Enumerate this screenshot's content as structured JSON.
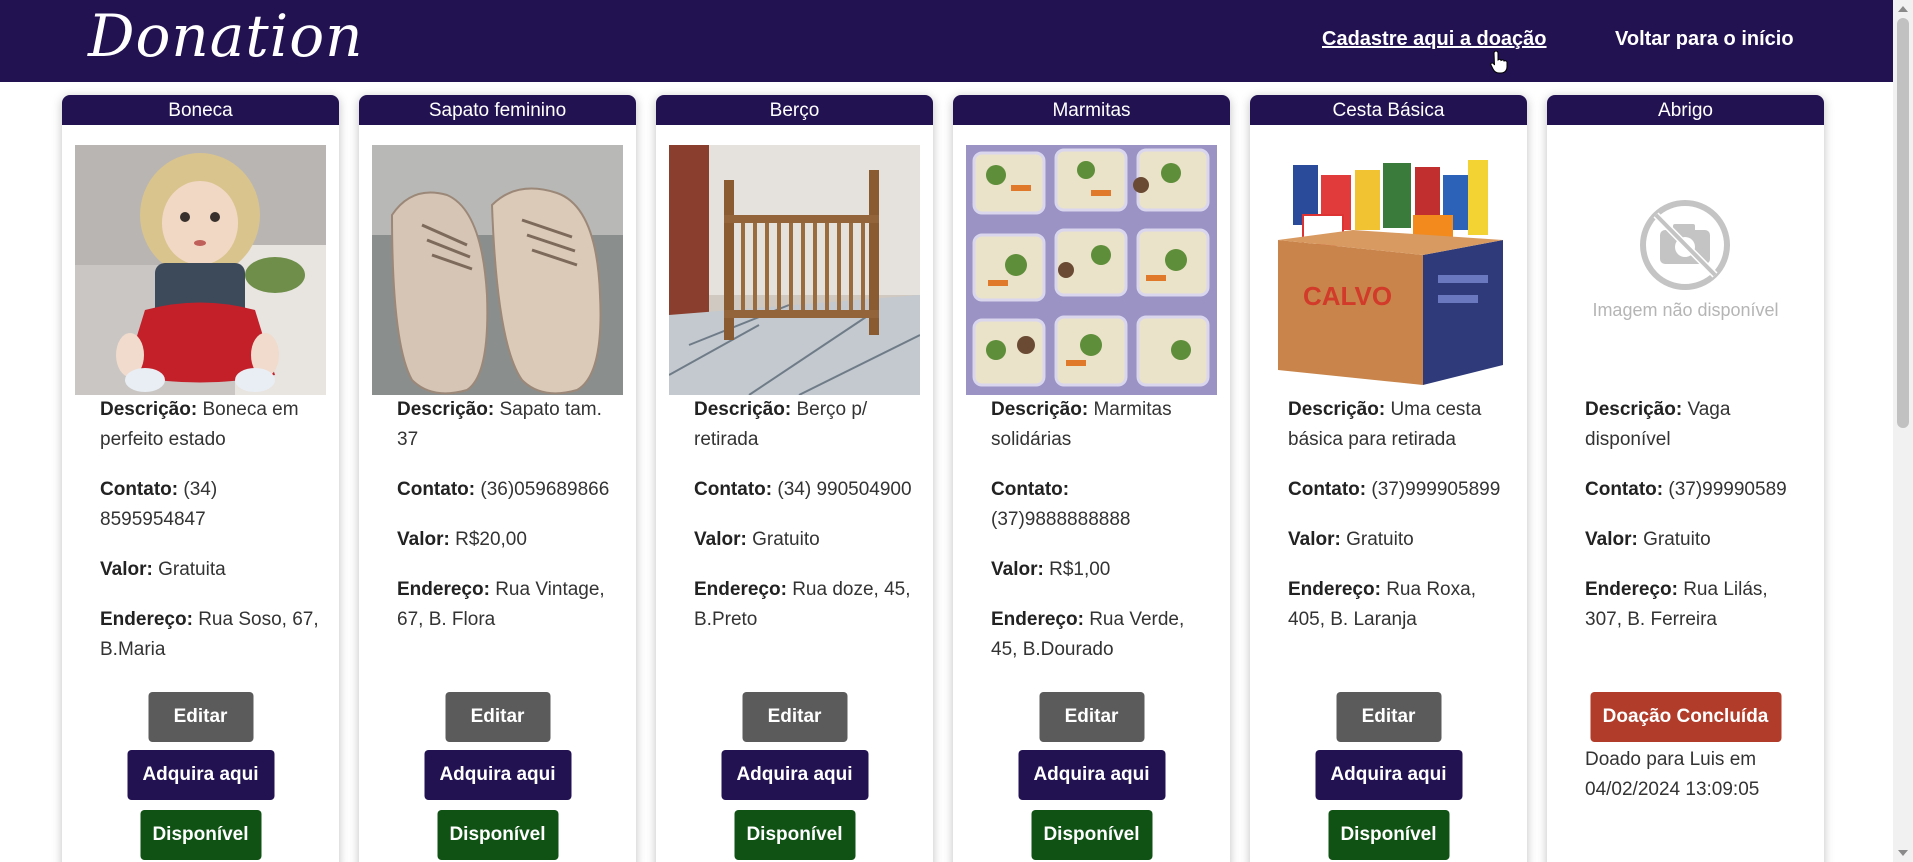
{
  "header": {
    "brand": "Donation",
    "links": {
      "cadastre": "Cadastre aqui a doação",
      "voltar": "Voltar para o início"
    }
  },
  "labels": {
    "descricao": "Descrição:",
    "contato": "Contato:",
    "valor": "Valor:",
    "endereco": "Endereço:"
  },
  "buttons": {
    "editar": "Editar",
    "adquira": "Adquira aqui",
    "disponivel": "Disponível",
    "concluida": "Doação Concluída"
  },
  "colors": {
    "navbar": "#221252",
    "edit": "#5b5b5b",
    "buy": "#221252",
    "available": "#0f5214",
    "done": "#b13c2a"
  },
  "cards": [
    {
      "title": "Boneca",
      "image": "doll-image",
      "descricao": "Boneca em perfeito estado",
      "contato": "(34) 8595954847",
      "valor": "Gratuita",
      "endereco": "Rua Soso, 67, B.Maria",
      "status": "available"
    },
    {
      "title": "Sapato feminino",
      "image": "shoes-image",
      "descricao": "Sapato tam. 37",
      "contato": "(36)059689866",
      "valor": "R$20,00",
      "endereco": "Rua Vintage, 67, B. Flora",
      "status": "available"
    },
    {
      "title": "Berço",
      "image": "crib-image",
      "descricao": "Berço p/ retirada",
      "contato": "(34) 990504900",
      "valor": "Gratuito",
      "endereco": "Rua doze, 45, B.Preto",
      "status": "available"
    },
    {
      "title": "Marmitas",
      "image": "meal-boxes-image",
      "descricao": "Marmitas solidárias",
      "contato": "(37)9888888888",
      "valor": "R$1,00",
      "endereco": "Rua Verde, 45, B.Dourado",
      "status": "available"
    },
    {
      "title": "Cesta Básica",
      "image": "food-basket-image",
      "image_text": "CALVO",
      "descricao": "Uma cesta básica para retirada",
      "contato": "(37)999905899",
      "valor": "Gratuito",
      "endereco": "Rua Roxa, 405, B. Laranja",
      "status": "available"
    },
    {
      "title": "Abrigo",
      "image": "image-unavailable-placeholder",
      "image_text": "Imagem não disponível",
      "descricao": "Vaga disponível",
      "contato": "(37)99990589",
      "valor": "Gratuito",
      "endereco": "Rua Lilás, 307, B. Ferreira",
      "status": "done",
      "donated": "Doado para Luis em 04/02/2024 13:09:05"
    }
  ]
}
